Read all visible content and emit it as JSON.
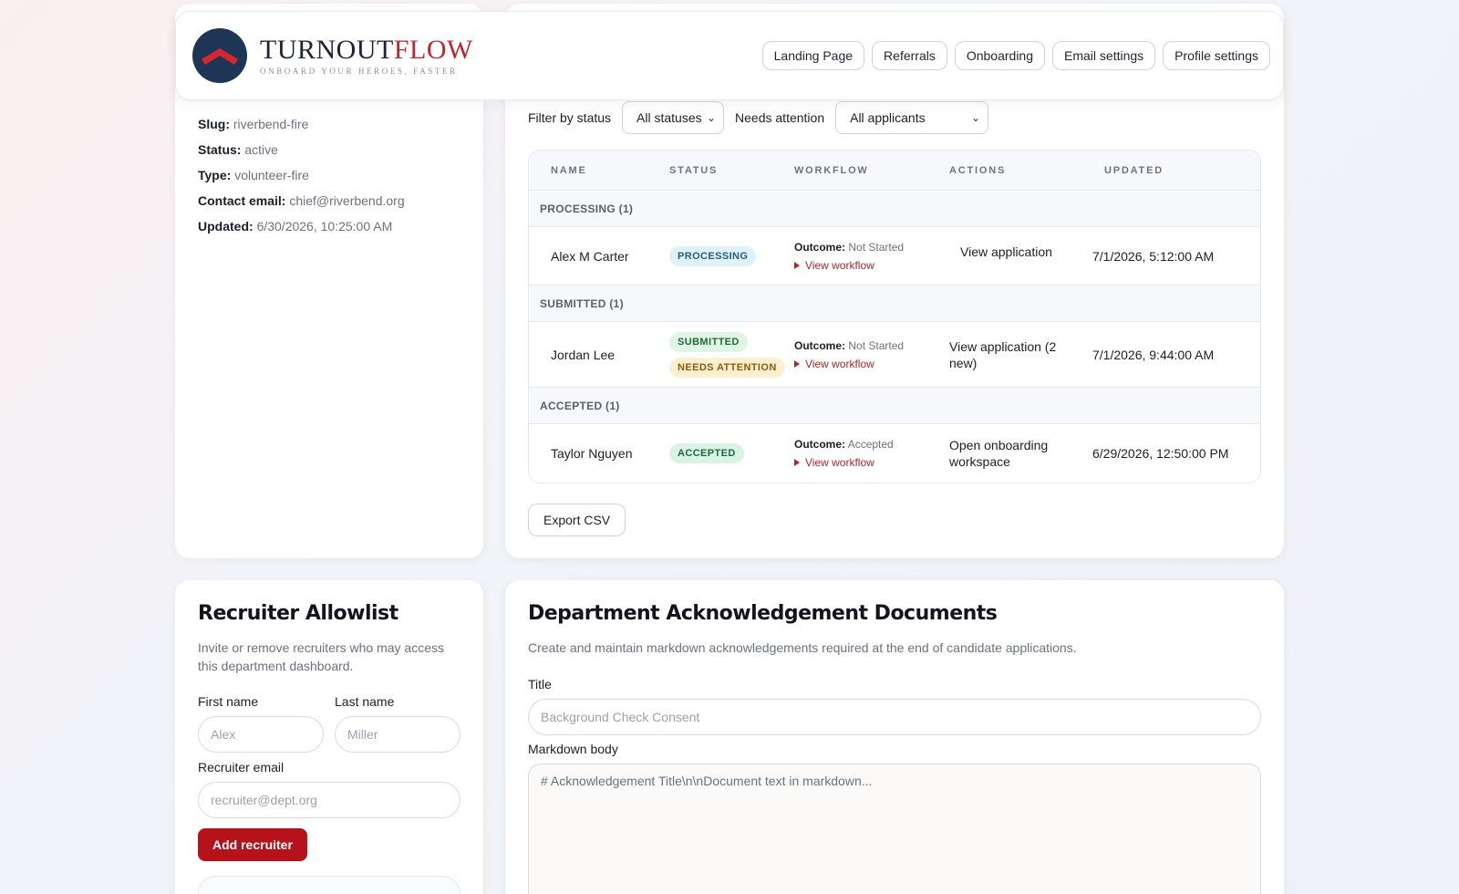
{
  "brand": {
    "name_part1": "TURNOUT",
    "name_part2": "FLOW",
    "tagline": "ONBOARD YOUR HEROES, FASTER"
  },
  "nav": [
    "Landing Page",
    "Referrals",
    "Onboarding",
    "Email settings",
    "Profile settings"
  ],
  "department": {
    "slug_label": "Slug:",
    "slug": "riverbend-fire",
    "status_label": "Status:",
    "status": "active",
    "type_label": "Type:",
    "type": "volunteer-fire",
    "contact_label": "Contact email:",
    "contact": "chief@riverbend.org",
    "updated_label": "Updated:",
    "updated": "6/30/2026, 10:25:00 AM"
  },
  "applications": {
    "filter_status_label": "Filter by status",
    "filter_status_value": "All statuses",
    "needs_attention_label": "Needs attention",
    "needs_attention_value": "All applicants",
    "columns": [
      "NAME",
      "STATUS",
      "WORKFLOW",
      "ACTIONS",
      "UPDATED"
    ],
    "outcome_label": "Outcome:",
    "view_workflow": "View workflow",
    "groups": [
      {
        "label": "PROCESSING (1)",
        "rows": [
          {
            "name": "Alex M Carter",
            "badges": [
              "PROCESSING"
            ],
            "outcome": "Not Started",
            "action": "View application",
            "updated": "7/1/2026, 5:12:00 AM"
          }
        ]
      },
      {
        "label": "SUBMITTED (1)",
        "rows": [
          {
            "name": "Jordan Lee",
            "badges": [
              "SUBMITTED",
              "NEEDS ATTENTION"
            ],
            "outcome": "Not Started",
            "action": "View application (2 new)",
            "updated": "7/1/2026, 9:44:00 AM"
          }
        ]
      },
      {
        "label": "ACCEPTED (1)",
        "rows": [
          {
            "name": "Taylor Nguyen",
            "badges": [
              "ACCEPTED"
            ],
            "outcome": "Accepted",
            "action": "Open onboarding workspace",
            "updated": "6/29/2026, 12:50:00 PM"
          }
        ]
      }
    ],
    "export_label": "Export CSV"
  },
  "allowlist": {
    "title": "Recruiter Allowlist",
    "subtitle": "Invite or remove recruiters who may access this department dashboard.",
    "first_label": "First name",
    "first_placeholder": "Alex",
    "last_label": "Last name",
    "last_placeholder": "Miller",
    "email_label": "Recruiter email",
    "email_placeholder": "recruiter@dept.org",
    "add_label": "Add recruiter"
  },
  "documents": {
    "title": "Department Acknowledgement Documents",
    "subtitle": "Create and maintain markdown acknowledgements required at the end of candidate applications.",
    "title_label": "Title",
    "title_placeholder": "Background Check Consent",
    "body_label": "Markdown body",
    "body_placeholder": "# Acknowledgement Title\\n\\nDocument text in markdown..."
  },
  "colors": {
    "brand_red": "#b5121b",
    "navy": "#1d3557"
  }
}
